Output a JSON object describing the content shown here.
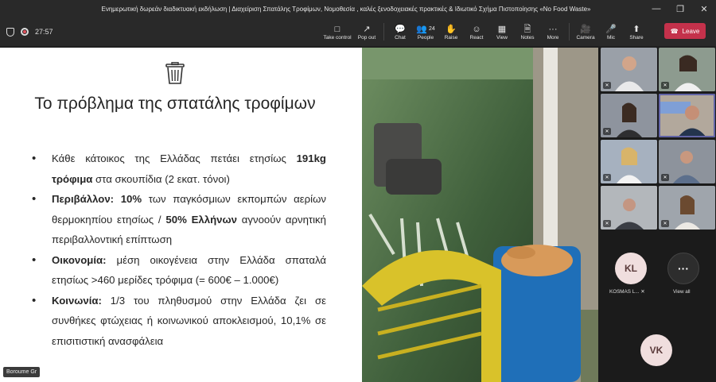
{
  "window": {
    "title": "Ενημερωτική δωρεάν διαδικτυακή εκδήλωση | Διαχείριση Σπατάλης Τροφίμων, Νομοθεσία , καλές ξενοδοχειακές πρακτικές & Ιδιωτικό Σχήμα Πιστοποίησης «No Food Waste»",
    "minimize_icon": "minimize-icon",
    "restore_icon": "restore-icon",
    "close_icon": "close-icon"
  },
  "toolbar": {
    "timer": "27:57",
    "buttons": [
      {
        "label": "Take control",
        "icon": "take-control-icon"
      },
      {
        "label": "Pop out",
        "icon": "pop-out-icon"
      },
      {
        "label": "Chat",
        "icon": "chat-icon"
      },
      {
        "label": "People",
        "icon": "people-icon",
        "count": "24"
      },
      {
        "label": "Raise",
        "icon": "raise-hand-icon"
      },
      {
        "label": "React",
        "icon": "react-icon"
      },
      {
        "label": "View",
        "icon": "view-icon"
      },
      {
        "label": "Notes",
        "icon": "notes-icon"
      },
      {
        "label": "More",
        "icon": "more-icon"
      },
      {
        "label": "Camera",
        "icon": "camera-off-icon"
      },
      {
        "label": "Mic",
        "icon": "mic-off-icon"
      },
      {
        "label": "Share",
        "icon": "share-icon"
      }
    ],
    "leave_label": "Leave",
    "leave_color": "#c4314b"
  },
  "slide": {
    "title": "Το πρόβλημα της σπατάλης τροφίμων",
    "bullets": [
      {
        "pre": "Κάθε κάτοικος της Ελλάδας πετάει ετησίως ",
        "bold": "191kg τρόφιμα",
        "post": " στα σκουπίδια (2 εκατ. τόνοι)"
      },
      {
        "bold": "Περιβάλλον: 10%",
        "mid": " των παγκόσμιων εκπομπών αερίων θερμοκηπίου ετησίως / ",
        "bold2": "50% Ελλήνων",
        "post": " αγνοούν αρνητική περιβαλλοντική επίπτωση"
      },
      {
        "bold": "Οικονομία:",
        "post": " μέση οικογένεια στην Ελλάδα σπαταλά ετησίως >460 μερίδες τρόφιμα (= 600€ – 1.000€)"
      },
      {
        "bold": "Κοινωνία:",
        "post": " 1/3 του πληθυσμού στην Ελλάδα ζει σε συνθήκες φτώχειας ή κοινωνικού αποκλεισμού, 10,1% σε επισιτιστική ανασφάλεια"
      }
    ],
    "presenter_caption": "Boroume Gr"
  },
  "participants": {
    "kl_initials": "KL",
    "kl_name": "KOSMAS L...",
    "view_all_label": "View all",
    "vk_initials": "VK"
  }
}
